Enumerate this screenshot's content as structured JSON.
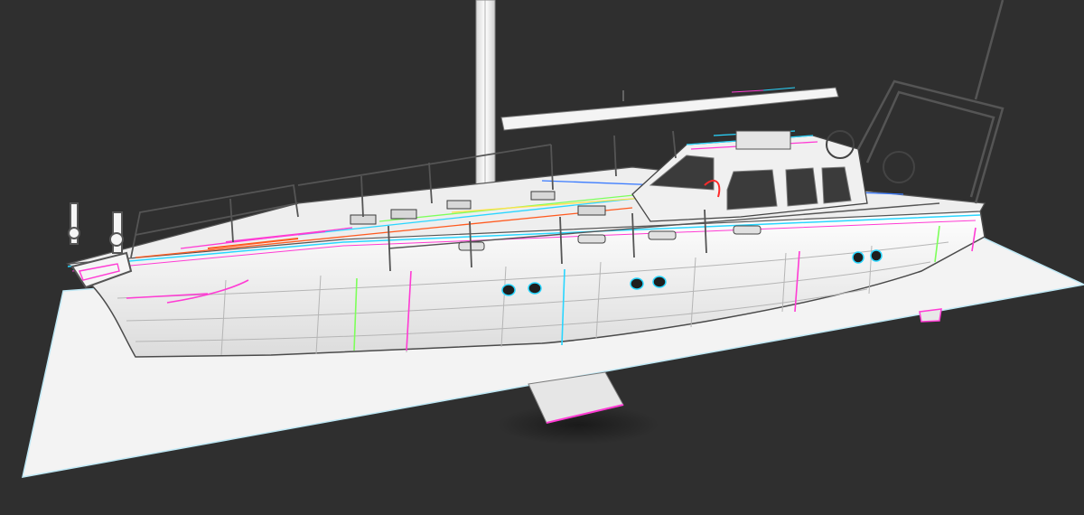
{
  "viewport": {
    "background_color": "#2f2f2f",
    "ground_plane_color": "#f2f2f2",
    "hull_color": "#fafafa",
    "edge_color": "#3a3a3a",
    "highlight_colors": [
      "#ff3bd4",
      "#29d6ff",
      "#7dff5a",
      "#ff5a1f",
      "#ffe14a",
      "#3a7bff"
    ]
  },
  "model": {
    "icon": "sailboat-wireframe-model"
  }
}
